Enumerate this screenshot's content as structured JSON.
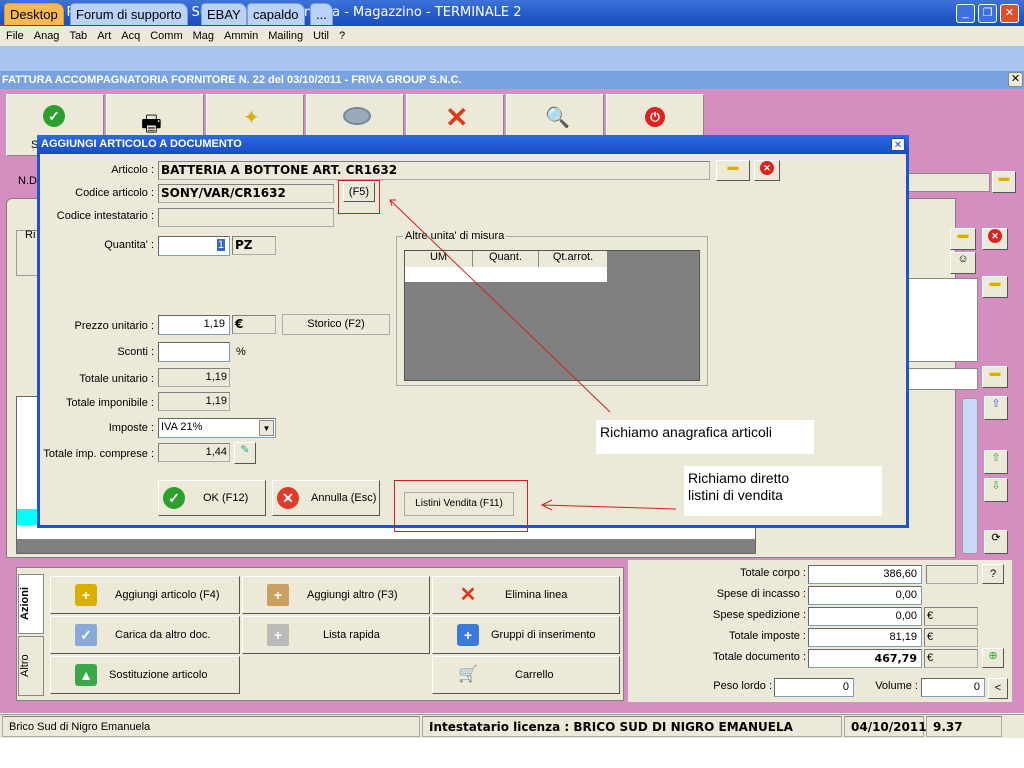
{
  "window": {
    "title": "Ready Pro V13.9.5 - Brico Sud di Nigro Emanuela - Magazzino - TERMINALE 2",
    "min": "_",
    "max": "❐",
    "close": "✕"
  },
  "menu": [
    "File",
    "Anag",
    "Tab",
    "Art",
    "Acq",
    "Comm",
    "Mag",
    "Ammin",
    "Mailing",
    "Util",
    "?"
  ],
  "tabs": [
    "Desktop",
    "Forum di supporto",
    "EBAY",
    "capaldo",
    "..."
  ],
  "document_title": "FATTURA ACCOMPAGNATORIA FORNITORE N. 22  del 03/10/2011 - FRIVA GROUP S.N.C.",
  "toolbar": {
    "save_partial": "S"
  },
  "background": {
    "nd_label": "N.D",
    "ri_label": "Ri",
    "n_label": "N",
    "r_label": "R"
  },
  "dialog": {
    "title": "AGGIUNGI ARTICOLO A DOCUMENTO",
    "articolo_label": "Articolo :",
    "articolo": "BATTERIA A BOTTONE ART. CR1632",
    "codice_label": "Codice articolo :",
    "codice": "SONY/VAR/CR1632",
    "f5": "(F5)",
    "codice_int_label": "Codice intestatario :",
    "codice_int": "",
    "quantita_label": "Quantita' :",
    "quantita": "1",
    "um": "PZ",
    "altre_um_label": "Altre unita' di misura",
    "altre_cols": [
      "UM",
      "Quant.",
      "Qt.arrot."
    ],
    "prezzo_label": "Prezzo unitario :",
    "prezzo": "1,19",
    "valuta": "€",
    "storico": "Storico (F2)",
    "sconti_label": "Sconti :",
    "sconti": "",
    "pct": "%",
    "tot_unit_label": "Totale unitario :",
    "tot_unit": "1,19",
    "tot_imp_label": "Totale imponibile :",
    "tot_imp": "1,19",
    "imposte_label": "Imposte :",
    "imposte": "IVA 21%",
    "tot_comp_label": "Totale imp. comprese :",
    "tot_comp": "1,44",
    "ok": "OK (F12)",
    "annulla": "Annulla (Esc)",
    "listini": "Listini Vendita  (F11)"
  },
  "annotations": {
    "anagrafica": "Richiamo anagrafica articoli",
    "listini": "Richiamo diretto\n listini di vendita"
  },
  "actions": {
    "side_tabs": [
      "Azioni",
      "Altro"
    ],
    "buttons": [
      "Aggiungi articolo (F4)",
      "Aggiungi altro (F3)",
      "Elimina linea",
      "Carica da altro doc.",
      "Lista rapida",
      "Gruppi di inserimento",
      "Sostituzione articolo",
      "Carrello"
    ]
  },
  "totals": {
    "corpo_label": "Totale corpo :",
    "corpo": "386,60",
    "help": "?",
    "incasso_label": "Spese di incasso :",
    "incasso": "0,00",
    "spedizione_label": "Spese spedizione :",
    "spedizione": "0,00",
    "euro": "€",
    "imposte_label": "Totale imposte :",
    "imposte": "81,19",
    "documento_label": "Totale documento :",
    "documento": "467,79",
    "peso_label": "Peso lordo :",
    "peso": "0",
    "volume_label": "Volume :",
    "volume": "0",
    "less": "<"
  },
  "status": {
    "company": "Brico Sud di Nigro Emanuela",
    "license": "Intestatario licenza : BRICO SUD DI NIGRO EMANUELA",
    "date": "04/10/2011",
    "version": "9.37"
  },
  "colors": {
    "accent": "#2359c8",
    "pink": "#d48ec0"
  }
}
